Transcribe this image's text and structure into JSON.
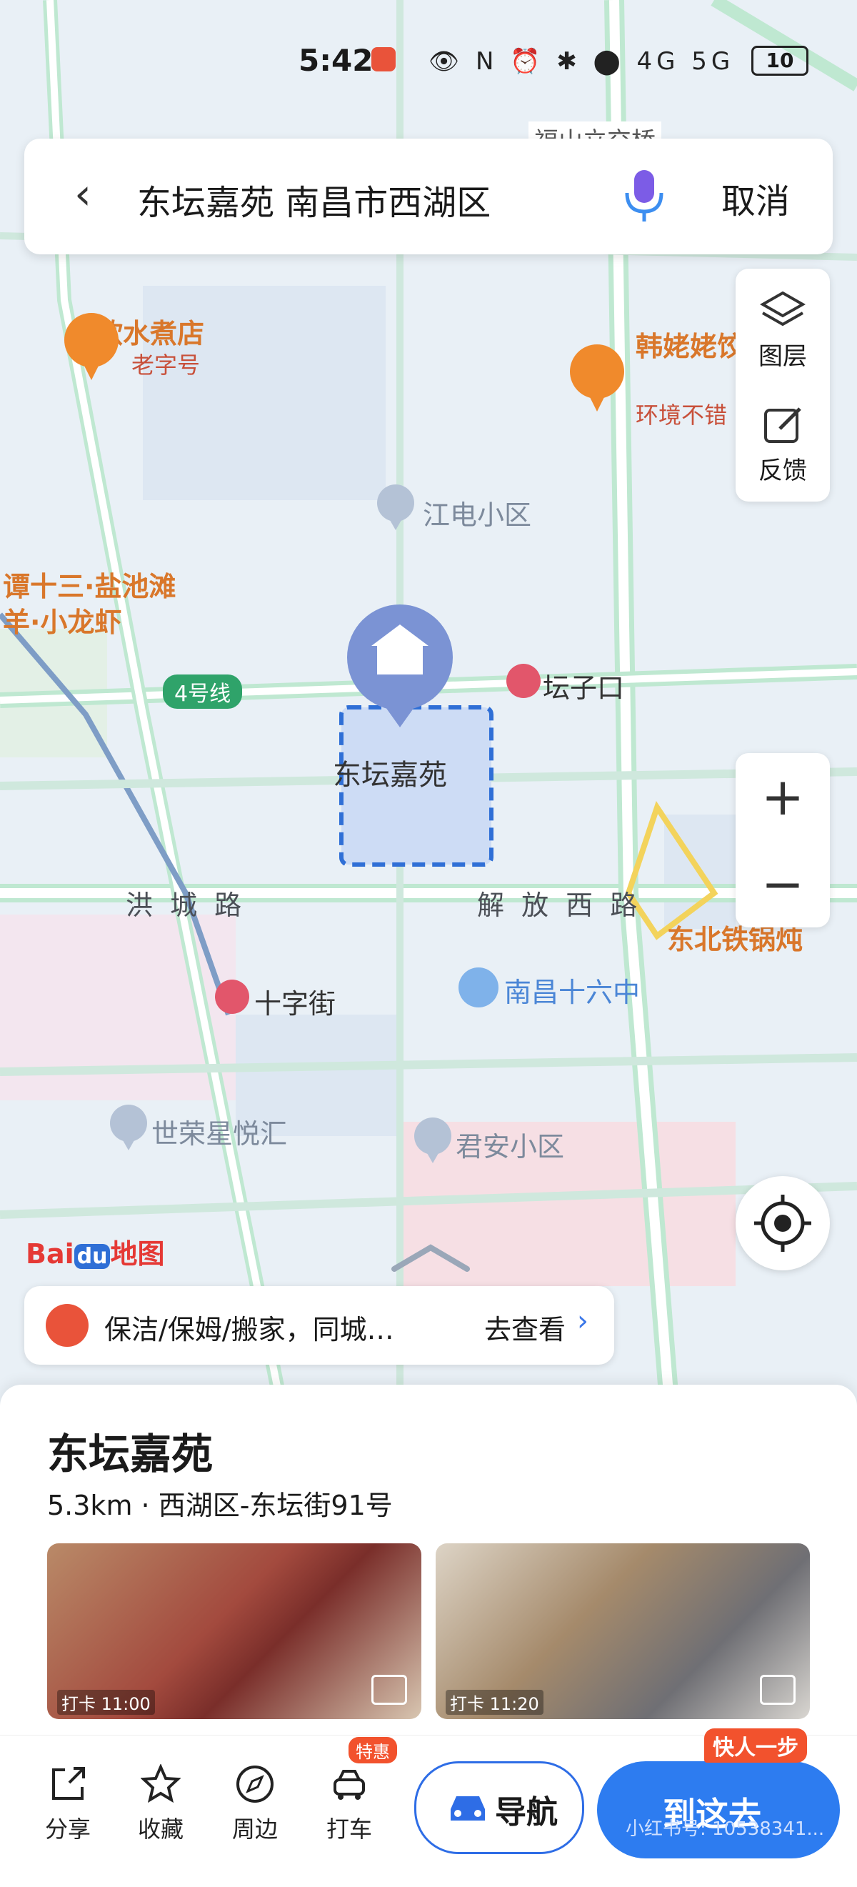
{
  "status_bar": {
    "time": "5:42",
    "battery": "10",
    "icons_text": "👁 N ⏰ ✱ ⬤ 4G 5G"
  },
  "search": {
    "query": "东坛嘉苑 南昌市西湖区",
    "cancel_label": "取消",
    "back_icon": "chevron-left-icon",
    "mic_icon": "microphone-icon"
  },
  "map_tools": {
    "layers_label": "图层",
    "feedback_label": "反馈",
    "zoom_in": "+",
    "zoom_out": "−"
  },
  "map": {
    "pois": [
      {
        "name": "小欧水煮店",
        "sub": "老字号"
      },
      {
        "name": "韩姥姥饺子王",
        "sub": "环境不错"
      },
      {
        "name": "江电小区"
      },
      {
        "name": "谭十三·盐池滩羊·小龙虾"
      },
      {
        "name": "坛子口"
      },
      {
        "name": "东坛嘉苑"
      },
      {
        "name": "东北铁锅炖"
      },
      {
        "name": "十字街"
      },
      {
        "name": "南昌十六中"
      },
      {
        "name": "世荣星悦汇"
      },
      {
        "name": "君安小区"
      },
      {
        "name": "福山立交桥"
      }
    ],
    "roads": [
      "洪 城 路",
      "解 放 西 路"
    ],
    "metro_line": "4号线",
    "logo": "Bai地图",
    "logo_text": {
      "bai": "Bai",
      "du": "du",
      "map": "地图"
    }
  },
  "promo": {
    "text": "保洁/保姆/搬家，同城…",
    "action": "去查看",
    "arrow": "›"
  },
  "place": {
    "title": "东坛嘉苑",
    "distance": "5.3km · 西湖区-东坛街91号",
    "photos": [
      {
        "stamp": "打卡 11:00"
      },
      {
        "stamp": "打卡 11:20"
      }
    ]
  },
  "actions": [
    {
      "label": "分享",
      "icon": "share-icon"
    },
    {
      "label": "收藏",
      "icon": "star-icon"
    },
    {
      "label": "周边",
      "icon": "compass-icon"
    },
    {
      "label": "打车",
      "icon": "taxi-icon",
      "badge": "特惠"
    }
  ],
  "nav_button": "导航",
  "go_button": "到这去",
  "go_tag": "快人一步",
  "watermark": "小红书号: 10538341..."
}
